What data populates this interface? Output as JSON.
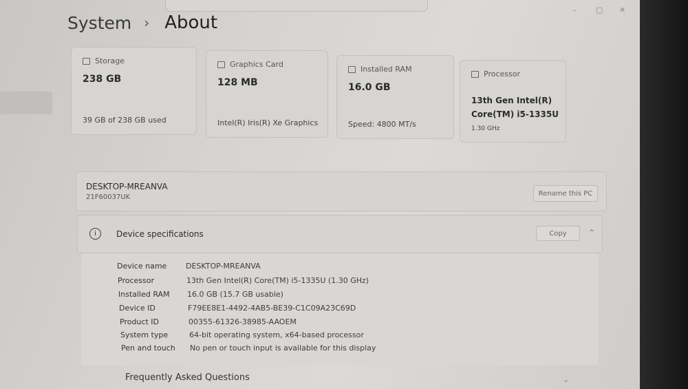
{
  "breadcrumb": {
    "parent": "System",
    "separator": "›",
    "current": "About"
  },
  "window_controls": {
    "minimize": "–",
    "maximize": "▢",
    "close": "✕"
  },
  "cards": [
    {
      "label": "Storage",
      "value": "238 GB",
      "sub": "39 GB of 238 GB used",
      "icon": "storage-icon"
    },
    {
      "label": "Graphics Card",
      "value": "128 MB",
      "sub": "Intel(R) Iris(R) Xe Graphics",
      "icon": "graphics-card-icon"
    },
    {
      "label": "Installed RAM",
      "value": "16.0 GB",
      "sub": "Speed: 4800 MT/s",
      "icon": "ram-icon"
    },
    {
      "label": "Processor",
      "value_line1": "13th Gen Intel(R)",
      "value_line2": "Core(TM) i5-1335U",
      "sub": "1.30 GHz",
      "icon": "processor-icon"
    }
  ],
  "device": {
    "name": "DESKTOP-MREANVA",
    "id": "21F60037UK",
    "rename_label": "Rename this PC"
  },
  "specs": {
    "title": "Device specifications",
    "copy_label": "Copy",
    "rows": [
      {
        "key": "Device name",
        "value": "DESKTOP-MREANVA"
      },
      {
        "key": "Processor",
        "value": "13th Gen Intel(R) Core(TM) i5-1335U (1.30 GHz)"
      },
      {
        "key": "Installed RAM",
        "value": "16.0 GB (15.7 GB usable)"
      },
      {
        "key": "Device ID",
        "value": "F79EE8E1-4492-4AB5-BE39-C1C09A23C69D"
      },
      {
        "key": "Product ID",
        "value": "00355-61326-38985-AAOEM"
      },
      {
        "key": "System type",
        "value": "64-bit operating system, x64-based processor"
      },
      {
        "key": "Pen and touch",
        "value": "No pen or touch input is available for this display"
      }
    ]
  },
  "faq": {
    "title": "Frequently Asked Questions"
  }
}
